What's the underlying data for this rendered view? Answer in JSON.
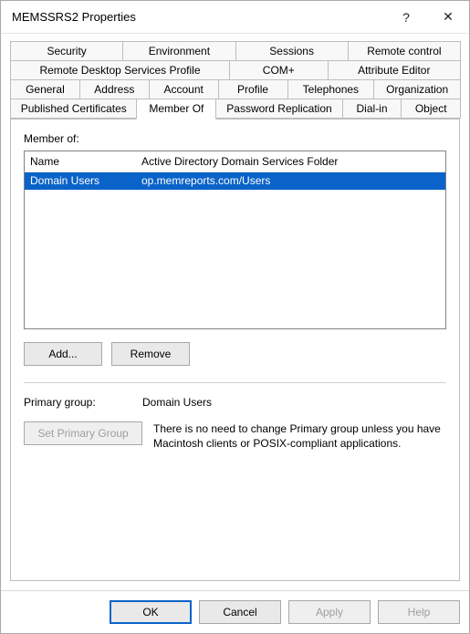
{
  "window": {
    "title": "MEMSSRS2 Properties"
  },
  "titlebar": {
    "help_symbol": "?",
    "close_symbol": "✕"
  },
  "tabs": {
    "row1": [
      "Security",
      "Environment",
      "Sessions",
      "Remote control"
    ],
    "row2": [
      "Remote Desktop Services Profile",
      "COM+",
      "Attribute Editor"
    ],
    "row3": [
      "General",
      "Address",
      "Account",
      "Profile",
      "Telephones",
      "Organization"
    ],
    "row4": [
      "Published Certificates",
      "Member Of",
      "Password Replication",
      "Dial-in",
      "Object"
    ],
    "active": "Member Of"
  },
  "member": {
    "label": "Member of:",
    "columns": {
      "name": "Name",
      "path": "Active Directory Domain Services Folder"
    },
    "rows": [
      {
        "name": "Domain Users",
        "path": "op.memreports.com/Users",
        "selected": true
      }
    ],
    "add_label": "Add...",
    "remove_label": "Remove"
  },
  "primary": {
    "label": "Primary group:",
    "value": "Domain Users",
    "set_btn": "Set Primary Group",
    "note": "There is no need to change Primary group unless you have Macintosh clients or POSIX-compliant applications."
  },
  "buttons": {
    "ok": "OK",
    "cancel": "Cancel",
    "apply": "Apply",
    "help": "Help"
  }
}
